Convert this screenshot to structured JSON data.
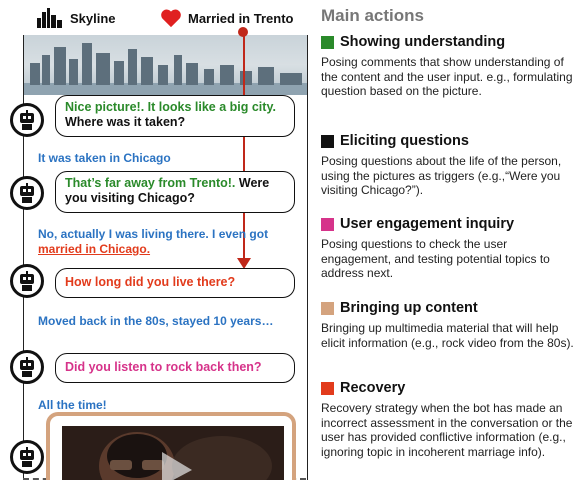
{
  "tags": {
    "skyline": "Skyline",
    "married": "Married in Trento"
  },
  "chat": [
    {
      "type": "bot",
      "parts": [
        {
          "text": "Nice picture!. It looks like a big city.",
          "color": "#2a8a2a"
        },
        {
          "text": " Where was it taken?",
          "color": "#111111"
        }
      ]
    },
    {
      "type": "user",
      "parts": [
        {
          "text": "It was taken in Chicago"
        }
      ]
    },
    {
      "type": "bot",
      "parts": [
        {
          "text": "That’s far away from Trento!.",
          "color": "#2a8a2a"
        },
        {
          "text": " Were you visiting Chicago?",
          "color": "#111111"
        }
      ]
    },
    {
      "type": "user",
      "parts": [
        {
          "text": "No, actually I was living there. I even got "
        },
        {
          "text": "married in Chicago.",
          "color": "#e23b1c",
          "underline": true
        }
      ]
    },
    {
      "type": "bot",
      "parts": [
        {
          "text": "How long did you live there?",
          "color": "#e23b1c"
        }
      ]
    },
    {
      "type": "user",
      "parts": [
        {
          "text": "Moved back in the 80s, stayed 10 years…"
        }
      ]
    },
    {
      "type": "bot",
      "parts": [
        {
          "text": "Did you listen to rock back then?",
          "color": "#d6338a"
        }
      ]
    },
    {
      "type": "user",
      "parts": [
        {
          "text": "All the time!"
        }
      ]
    }
  ],
  "right": {
    "title": "Main actions",
    "sections": [
      {
        "heading": "Showing understanding",
        "color": "#2a8a2a",
        "desc": "Posing comments that show understanding of the content and the user input. e.g., formulating question based on the picture."
      },
      {
        "heading": "Eliciting questions",
        "color": "#111111",
        "desc": "Posing questions about the life of the person, using the pictures as triggers (e.g.,“Were you visiting Chicago?”)."
      },
      {
        "heading": "User engagement inquiry",
        "color": "#d6338a",
        "desc": "Posing questions to check the user engagement, and testing potential topics to address next."
      },
      {
        "heading": "Bringing up content",
        "color": "#d4a37e",
        "desc": "Bringing up multimedia material that will help elicit information (e.g., rock video from the 80s)."
      },
      {
        "heading": "Recovery",
        "color": "#e23b1c",
        "desc": "Recovery strategy when the bot has made an incorrect assessment in the conversation or the user has provided conflictive information (e.g., ignoring topic in incoherent marriage info)."
      }
    ]
  }
}
